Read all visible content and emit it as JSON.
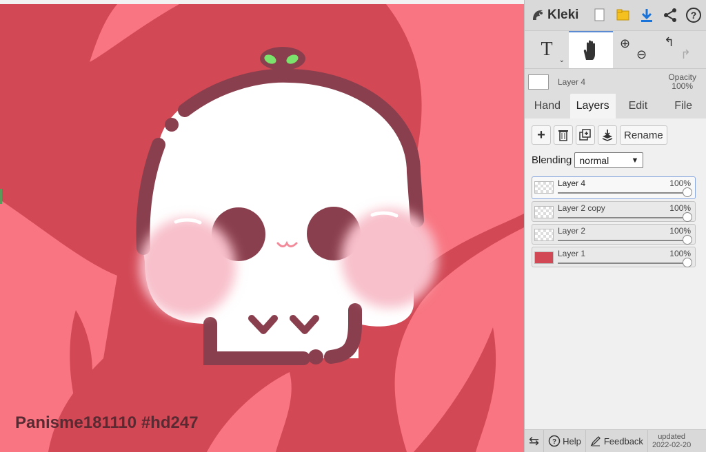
{
  "app": {
    "name": "Kleki"
  },
  "canvas": {
    "signature": "Panisme181110 #hd247"
  },
  "topbar": {
    "icons": [
      "new-image-icon",
      "open-folder-icon",
      "download-icon",
      "share-icon",
      "help-icon"
    ]
  },
  "tools": {
    "text_label": "T"
  },
  "layer_info": {
    "name": "Layer 4",
    "opacity_label": "Opacity",
    "opacity_value": "100%"
  },
  "tabs": [
    {
      "label": "Hand"
    },
    {
      "label": "Layers",
      "active": true
    },
    {
      "label": "Edit"
    },
    {
      "label": "File"
    }
  ],
  "layers_panel": {
    "add_label": "+",
    "rename_label": "Rename",
    "blending_label": "Blending",
    "blending_value": "normal",
    "layers": [
      {
        "name": "Layer 4",
        "opacity": "100%",
        "selected": true
      },
      {
        "name": "Layer 2 copy",
        "opacity": "100%"
      },
      {
        "name": "Layer 2",
        "opacity": "100%"
      },
      {
        "name": "Layer 1",
        "opacity": "100%"
      }
    ]
  },
  "bottombar": {
    "help_label": "Help",
    "feedback_label": "Feedback",
    "updated_label": "updated",
    "updated_date": "2022-02-20"
  },
  "colors": {
    "bg_dark": "#d24855",
    "bg_light": "#f87581",
    "outline": "#8a3f4e",
    "blush": "#f8c0cb",
    "sprout": "#7be36b"
  }
}
